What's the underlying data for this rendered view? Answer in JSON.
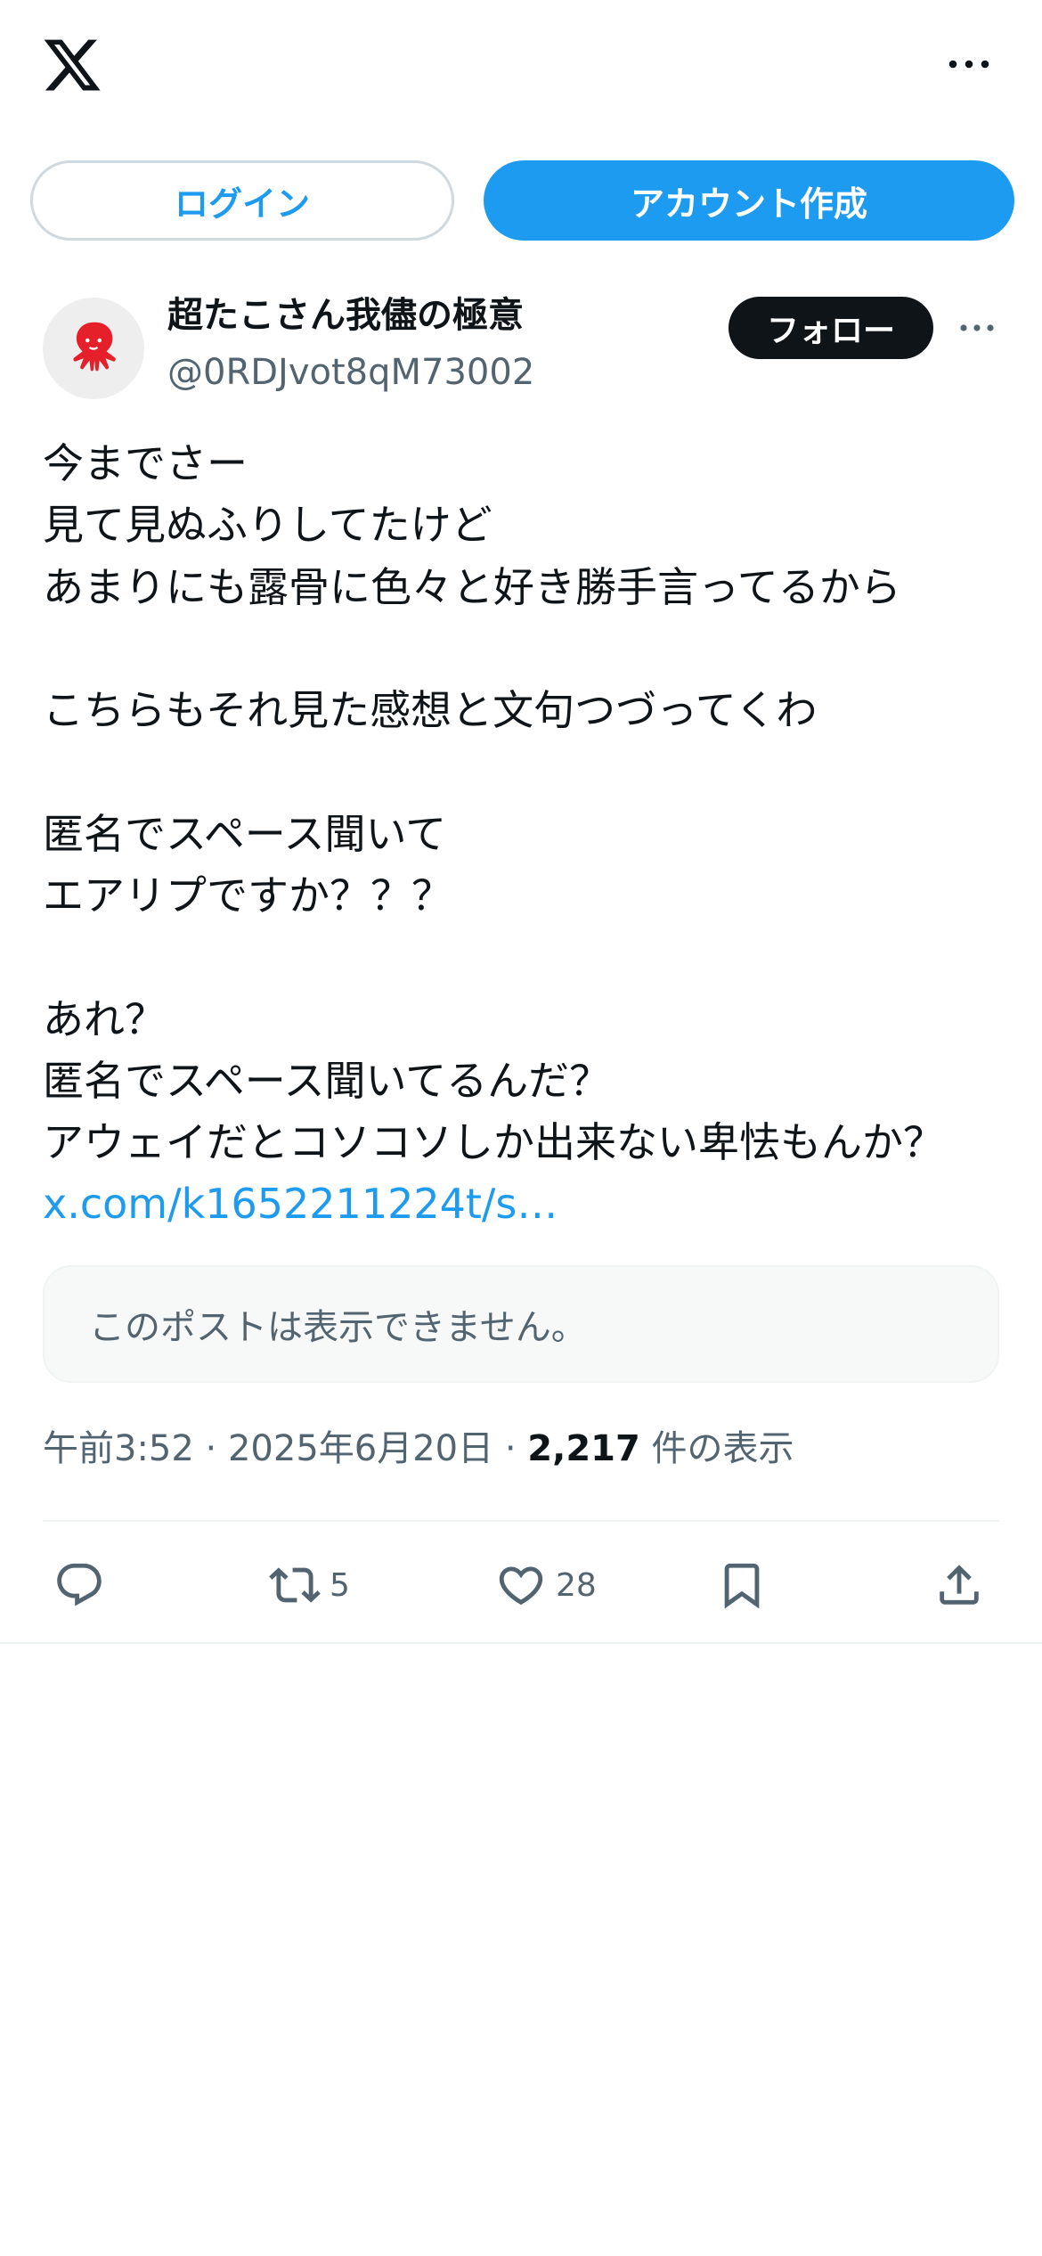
{
  "topbar": {
    "logo_icon": "x-logo-icon",
    "more_icon": "more-horizontal-icon"
  },
  "auth": {
    "login_label": "ログイン",
    "signup_label": "アカウント作成"
  },
  "author": {
    "display_name": "超たこさん我儘の極意",
    "handle": "@0RDJvot8qM73002",
    "avatar_icon": "octopus-icon",
    "follow_label": "フォロー"
  },
  "post": {
    "body": "今までさー\n見て見ぬふりしてたけど\nあまりにも露骨に色々と好き勝手言ってるから\n\nこちらもそれ見た感想と文句つづってくわ\n\n匿名でスペース聞いて\nエアリプですか？？？\n\nあれ？\n匿名でスペース聞いてるんだ？\nアウェイだとコソコソしか出来ない卑怯もんか？",
    "link": "x.com/k1652211224t/s…",
    "quote_unavailable": "このポストは表示できません。"
  },
  "meta": {
    "time": "午前3:52",
    "date": "2025年6月20日",
    "separator": " · ",
    "views": "2,217",
    "views_label": "件の表示"
  },
  "actions": {
    "reply_icon": "reply-icon",
    "retweet_icon": "retweet-icon",
    "retweet_count": "5",
    "like_icon": "heart-icon",
    "like_count": "28",
    "bookmark_icon": "bookmark-icon",
    "share_icon": "share-icon"
  },
  "colors": {
    "accent": "#1d9bf0",
    "text": "#0f1419",
    "secondary": "#536471",
    "border": "#cfd9de",
    "avatar_red": "#e5202b"
  }
}
